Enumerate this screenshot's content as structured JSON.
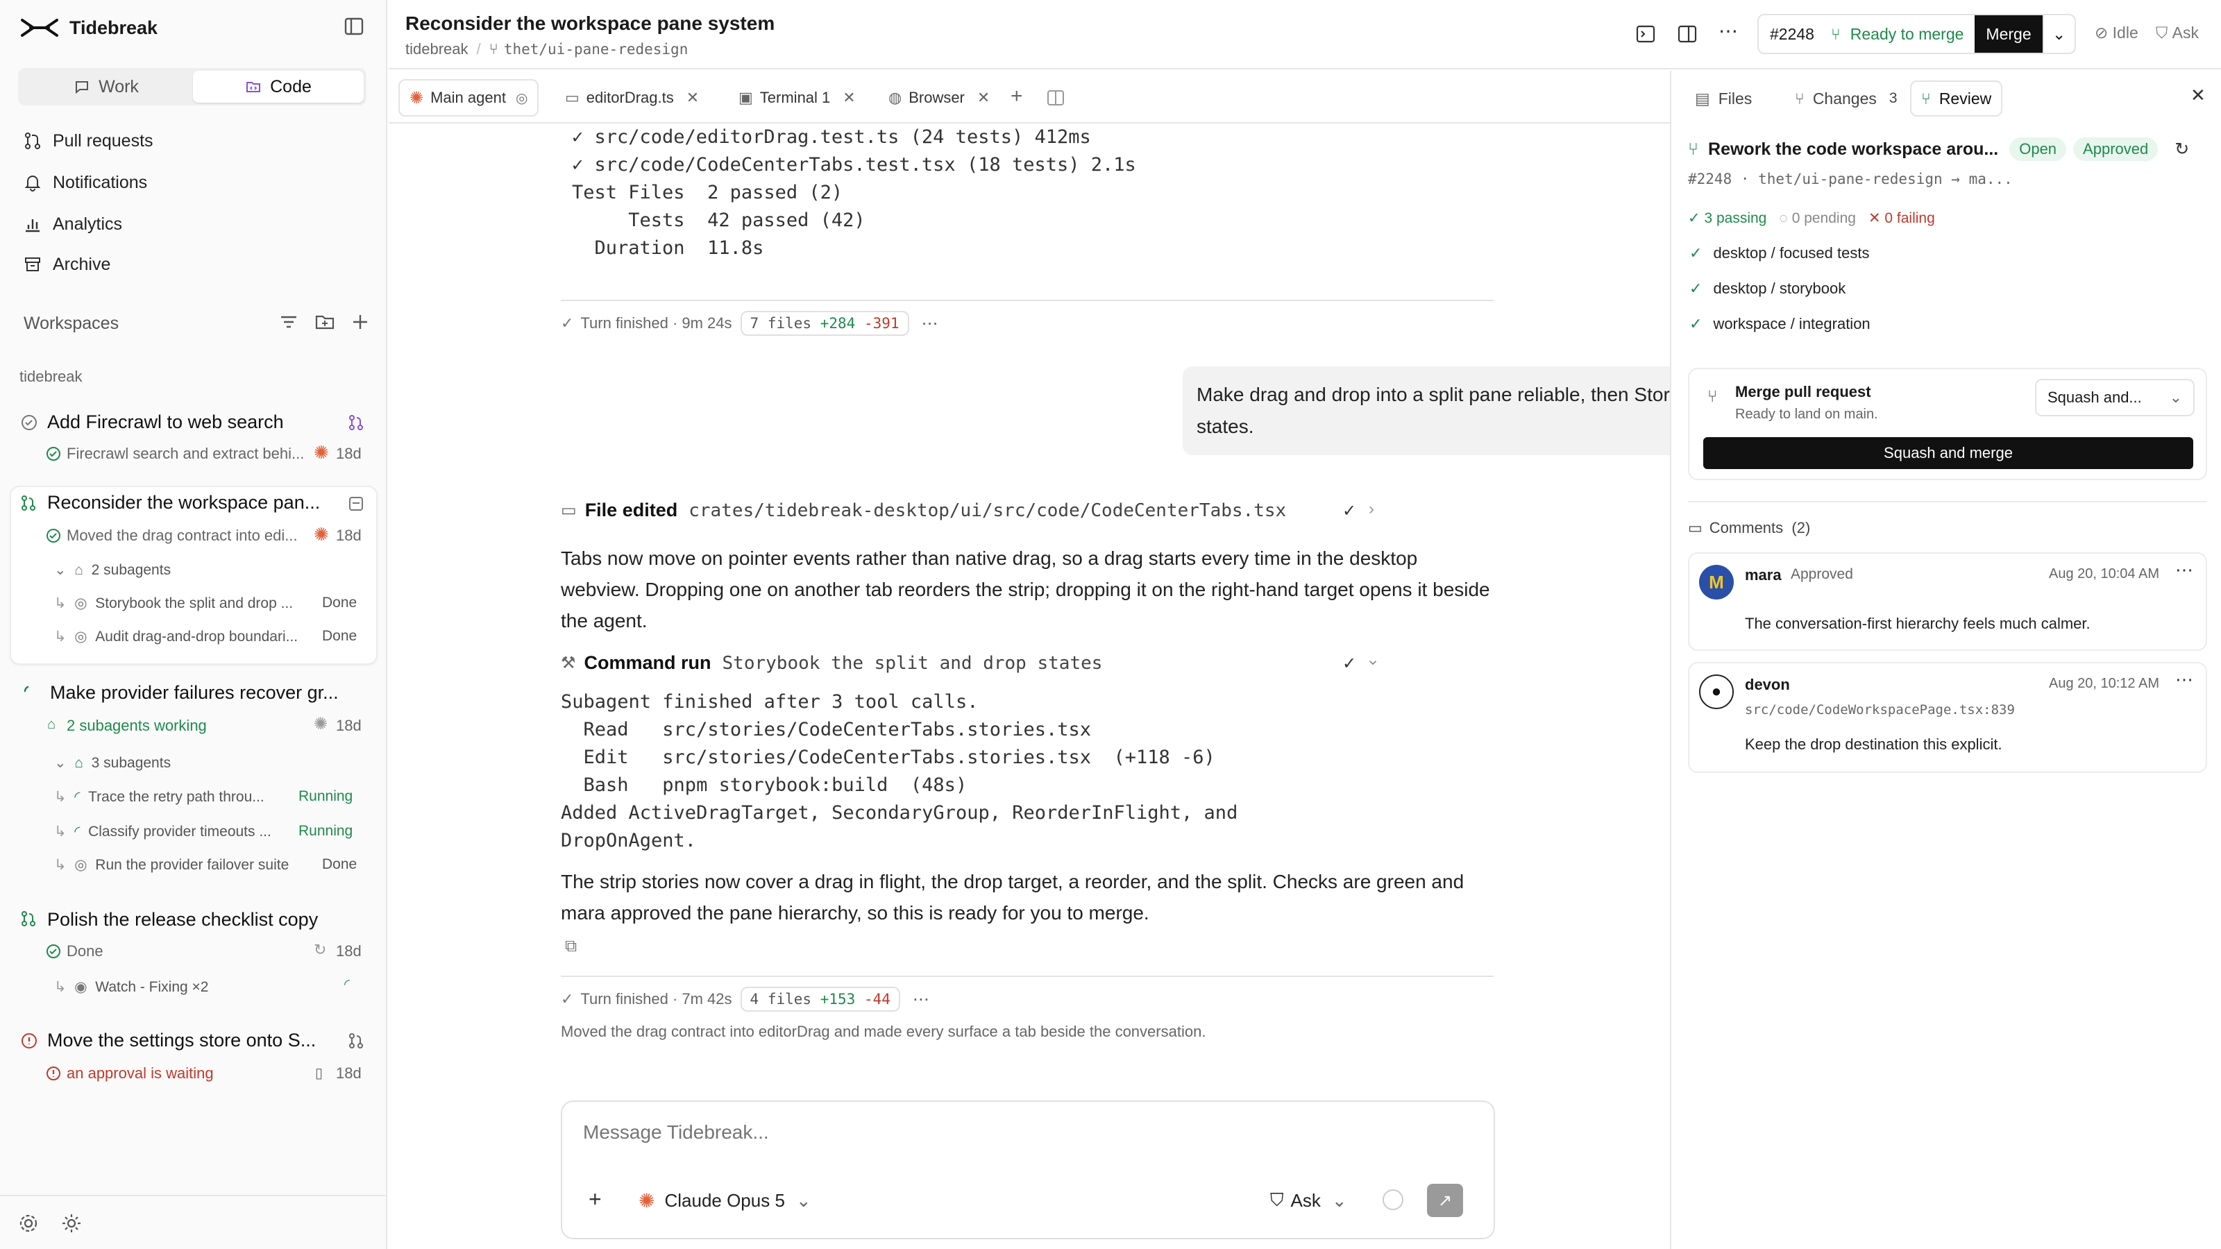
{
  "app": {
    "name": "Tidebreak"
  },
  "mode_switch": {
    "work": "Work",
    "code": "Code"
  },
  "nav": [
    {
      "label": "Pull requests"
    },
    {
      "label": "Notifications"
    },
    {
      "label": "Analytics"
    },
    {
      "label": "Archive"
    }
  ],
  "workspaces": {
    "heading": "Workspaces",
    "section": "tidebreak",
    "items": [
      {
        "title": "Add Firecrawl to web search",
        "subtitle": "Firecrawl search and extract behi...",
        "age": "18d"
      },
      {
        "title": "Reconsider the workspace pan...",
        "subtitle": "Moved the drag contract into edi...",
        "age": "18d",
        "subagents_label": "2 subagents",
        "subagents": [
          {
            "name": "Storybook the split and drop ...",
            "status": "Done"
          },
          {
            "name": "Audit drag-and-drop boundari...",
            "status": "Done"
          }
        ]
      },
      {
        "title": "Make provider failures recover gr...",
        "subtitle": "2 subagents working",
        "age": "18d",
        "subagents_label": "3 subagents",
        "subagents": [
          {
            "name": "Trace the retry path throu...",
            "status": "Running"
          },
          {
            "name": "Classify provider timeouts ...",
            "status": "Running"
          },
          {
            "name": "Run the provider failover suite",
            "status": "Done"
          }
        ]
      },
      {
        "title": "Polish the release checklist copy",
        "subtitle": "Done",
        "age": "18d",
        "watch": "Watch - Fixing ×2"
      },
      {
        "title": "Move the settings store onto S...",
        "subtitle": "an approval is waiting",
        "age": "18d"
      }
    ]
  },
  "header": {
    "title": "Reconsider the workspace pane system",
    "repo": "tidebreak",
    "branch": "thet/ui-pane-redesign",
    "pr_number": "#2248",
    "status": "Ready to merge",
    "merge": "Merge",
    "idle": "Idle",
    "ask": "Ask"
  },
  "tabs": [
    {
      "label": "Main agent"
    },
    {
      "label": "editorDrag.ts"
    },
    {
      "label": "Terminal 1"
    },
    {
      "label": "Browser"
    }
  ],
  "conversation": {
    "test_output": [
      "✓ src/code/editorDrag.test.ts (24 tests) 412ms",
      "✓ src/code/CodeCenterTabs.test.tsx (18 tests) 2.1s",
      "",
      "Test Files  2 passed (2)",
      "     Tests  42 passed (42)",
      "  Duration  11.8s"
    ],
    "turn1": {
      "label": "Turn finished",
      "duration": "· 9m 24s",
      "files": "7 files",
      "plus": "+284",
      "minus": "-391"
    },
    "user_message": "Make drag and drop into a split pane reliable, then Storybook the important states.",
    "file_edit": {
      "label": "File edited",
      "path": "crates/tidebreak-desktop/ui/src/code/CodeCenterTabs.tsx"
    },
    "para1": "Tabs now move on pointer events rather than native drag, so a drag starts every time in the desktop webview. Dropping one on another tab reorders the strip; dropping it on the right-hand target opens it beside the agent.",
    "command": {
      "label": "Command run",
      "name": "Storybook the split and drop states"
    },
    "command_output": [
      "Subagent finished after 3 tool calls.",
      "  Read   src/stories/CodeCenterTabs.stories.tsx",
      "  Edit   src/stories/CodeCenterTabs.stories.tsx  (+118 -6)",
      "  Bash   pnpm storybook:build  (48s)",
      "Added ActiveDragTarget, SecondaryGroup, ReorderInFlight, and",
      "DropOnAgent."
    ],
    "para2": "The strip stories now cover a drag in flight, the drop target, a reorder, and the split. Checks are green and mara approved the pane hierarchy, so this is ready for you to merge.",
    "turn2": {
      "label": "Turn finished",
      "duration": "· 7m 42s",
      "files": "4 files",
      "plus": "+153",
      "minus": "-44"
    },
    "summary": "Moved the drag contract into editorDrag and made every surface a tab beside the conversation."
  },
  "composer": {
    "placeholder": "Message Tidebreak...",
    "model": "Claude Opus 5",
    "mode": "Ask"
  },
  "right_panel": {
    "tabs": [
      {
        "label": "Files"
      },
      {
        "label": "Changes",
        "count": "3"
      },
      {
        "label": "Review"
      }
    ],
    "pr": {
      "title": "Rework the code workspace arou...",
      "open": "Open",
      "approved": "Approved",
      "meta": "#2248 · thet/ui-pane-redesign → ma..."
    },
    "checks_summary": {
      "passing": "3 passing",
      "pending": "0 pending",
      "failing": "0 failing"
    },
    "checks": [
      {
        "label": "desktop / focused tests"
      },
      {
        "label": "desktop / storybook"
      },
      {
        "label": "workspace / integration"
      }
    ],
    "merge_box": {
      "title": "Merge pull request",
      "subtitle": "Ready to land on main.",
      "strategy": "Squash and...",
      "button": "Squash and merge"
    },
    "comments_heading": "Comments",
    "comments_count": "(2)",
    "comments": [
      {
        "author": "mara",
        "tag": "Approved",
        "time": "Aug 20, 10:04 AM",
        "ref": "",
        "body": "The conversation-first hierarchy feels much calmer."
      },
      {
        "author": "devon",
        "tag": "",
        "time": "Aug 20, 10:12 AM",
        "ref": "src/code/CodeWorkspacePage.tsx:839",
        "body": "Keep the drop destination this explicit."
      }
    ]
  },
  "colors": {
    "accent_green": "#1f8a4c",
    "danger": "#c0392b",
    "agent_orange": "#e0613a",
    "subagent_purple": "#8a4fd6"
  }
}
